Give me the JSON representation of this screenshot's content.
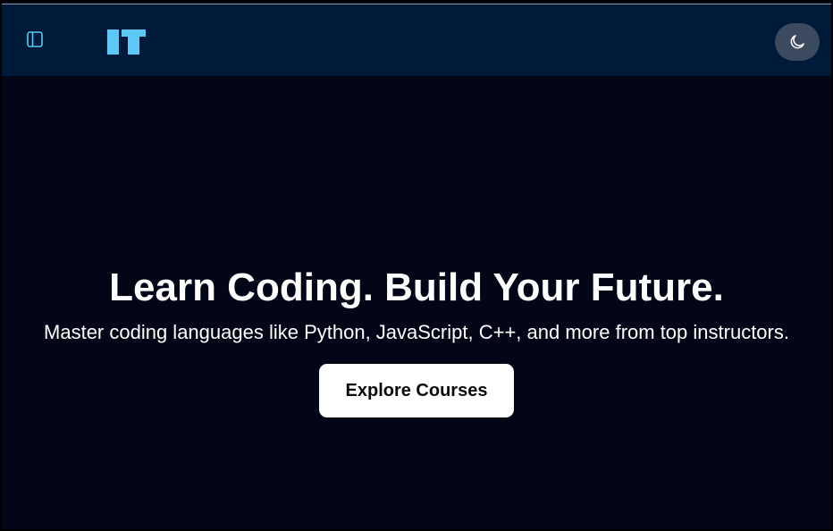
{
  "header": {
    "logo_text": "IT",
    "logo_color": "#5bc8f5",
    "background_color": "#001a3a",
    "icons": {
      "sidebar_toggle": "sidebar-panel-icon",
      "theme_toggle": "moon-icon"
    }
  },
  "hero": {
    "title": "Learn Coding. Build Your Future.",
    "subtitle": "Master coding languages like Python, JavaScript, C++, and more from top instructors.",
    "cta_label": "Explore Courses",
    "background_color": "#020617"
  }
}
